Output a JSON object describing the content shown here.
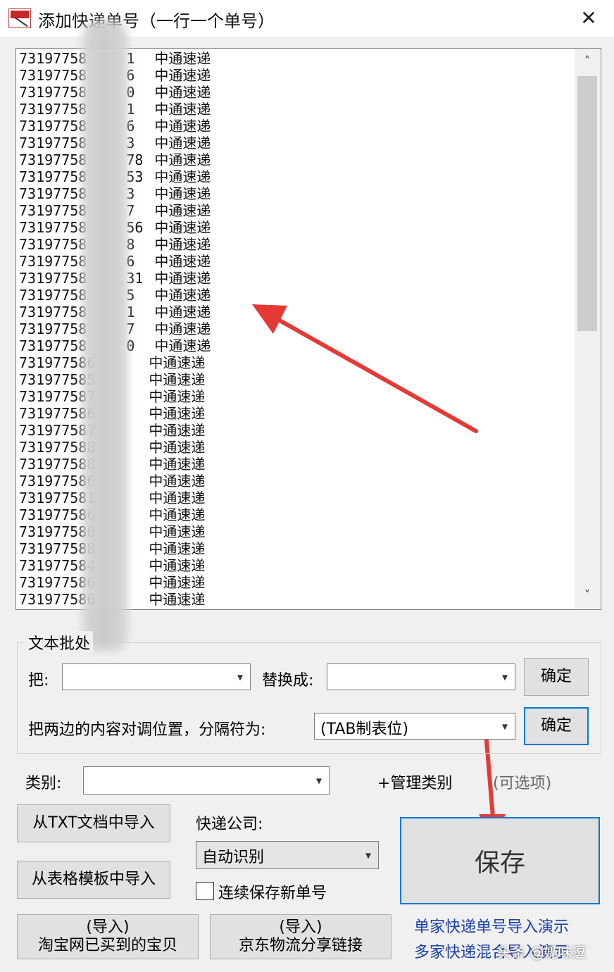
{
  "window": {
    "title": "添加快递单号（一行一个单号）",
    "close_glyph": "✕"
  },
  "textbox": {
    "rows": [
      {
        "no": "73197758",
        "tail": "1",
        "carrier": "中通速递"
      },
      {
        "no": "73197758",
        "tail": "6",
        "carrier": "中通速递"
      },
      {
        "no": "73197758",
        "tail": "0",
        "carrier": "中通速递"
      },
      {
        "no": "73197758",
        "tail": "1",
        "carrier": "中通速递"
      },
      {
        "no": "73197758",
        "tail": "6",
        "carrier": "中通速递"
      },
      {
        "no": "73197758",
        "tail": "3",
        "carrier": "中通速递"
      },
      {
        "no": "73197758",
        "tail": "78",
        "carrier": "中通速递"
      },
      {
        "no": "73197758",
        "tail": "53",
        "carrier": "中通速递"
      },
      {
        "no": "73197758",
        "tail": "3",
        "carrier": "中通速递"
      },
      {
        "no": "73197758",
        "tail": "7",
        "carrier": "中通速递"
      },
      {
        "no": "73197758",
        "tail": "56",
        "carrier": "中通速递"
      },
      {
        "no": "73197758",
        "tail": "8",
        "carrier": "中通速递"
      },
      {
        "no": "73197758",
        "tail": "6",
        "carrier": "中通速递"
      },
      {
        "no": "73197758",
        "tail": "31",
        "carrier": "中通速递"
      },
      {
        "no": "73197758",
        "tail": "5",
        "carrier": "中通速递"
      },
      {
        "no": "73197758",
        "tail": "1",
        "carrier": "中通速递"
      },
      {
        "no": "73197758",
        "tail": "7",
        "carrier": "中通速递"
      },
      {
        "no": "73197758",
        "tail": "0",
        "carrier": "中通速递"
      },
      {
        "no": "731977586",
        "tail": "",
        "carrier": "中通速递"
      },
      {
        "no": "731977585",
        "tail": "",
        "carrier": "中通速递"
      },
      {
        "no": "731977587",
        "tail": "",
        "carrier": "中通速递"
      },
      {
        "no": "731977586",
        "tail": "",
        "carrier": "中通速递"
      },
      {
        "no": "731977587",
        "tail": "",
        "carrier": "中通速递"
      },
      {
        "no": "731977588",
        "tail": "",
        "carrier": "中通速递"
      },
      {
        "no": "731977588",
        "tail": "",
        "carrier": "中通速递"
      },
      {
        "no": "731977586",
        "tail": "",
        "carrier": "中通速递"
      },
      {
        "no": "731977581",
        "tail": "",
        "carrier": "中通速递"
      },
      {
        "no": "731977586",
        "tail": "",
        "carrier": "中通速递"
      },
      {
        "no": "731977580",
        "tail": "",
        "carrier": "中通速递"
      },
      {
        "no": "731977588",
        "tail": "",
        "carrier": "中通速递"
      },
      {
        "no": "731977584",
        "tail": "",
        "carrier": "中通速递"
      },
      {
        "no": "731977586",
        "tail": "",
        "carrier": "中通速递"
      },
      {
        "no": "731977586",
        "tail": "",
        "carrier": "中通速递"
      }
    ],
    "scroll_up": "˄",
    "scroll_down": "˅"
  },
  "batch": {
    "group_title": "文本批处",
    "replace_from_label": "把:",
    "replace_from_value": "",
    "replace_to_label": "替换成:",
    "replace_to_value": "",
    "confirm1": "确定",
    "swap_label": "把两边的内容对调位置，分隔符为:",
    "separator_value": "(TAB制表位)",
    "confirm2": "确定"
  },
  "category": {
    "label": "类别:",
    "value": "",
    "manage_link": "+管理类别",
    "optional_note": "(可选项)"
  },
  "import": {
    "from_txt": "从TXT文档中导入",
    "from_template": "从表格模板中导入",
    "taobao_line1": "(导入)",
    "taobao_line2": "淘宝网已买到的宝贝",
    "jd_line1": "(导入)",
    "jd_line2": "京东物流分享链接"
  },
  "courier": {
    "label": "快递公司:",
    "value": "自动识别"
  },
  "continuous": {
    "label": "连续保存新单号",
    "checked": false
  },
  "save": {
    "label": "保存"
  },
  "links": {
    "single": "单家快递单号导入演示",
    "multi": "多家快递混合导入演示"
  },
  "watermark": "头条 @奶味逗",
  "colors": {
    "accent": "#0078d7",
    "link": "#1a3fa8",
    "arrow": "#e53935"
  },
  "icons": {
    "dropdown": "chevron-down-icon",
    "close": "close-icon"
  }
}
